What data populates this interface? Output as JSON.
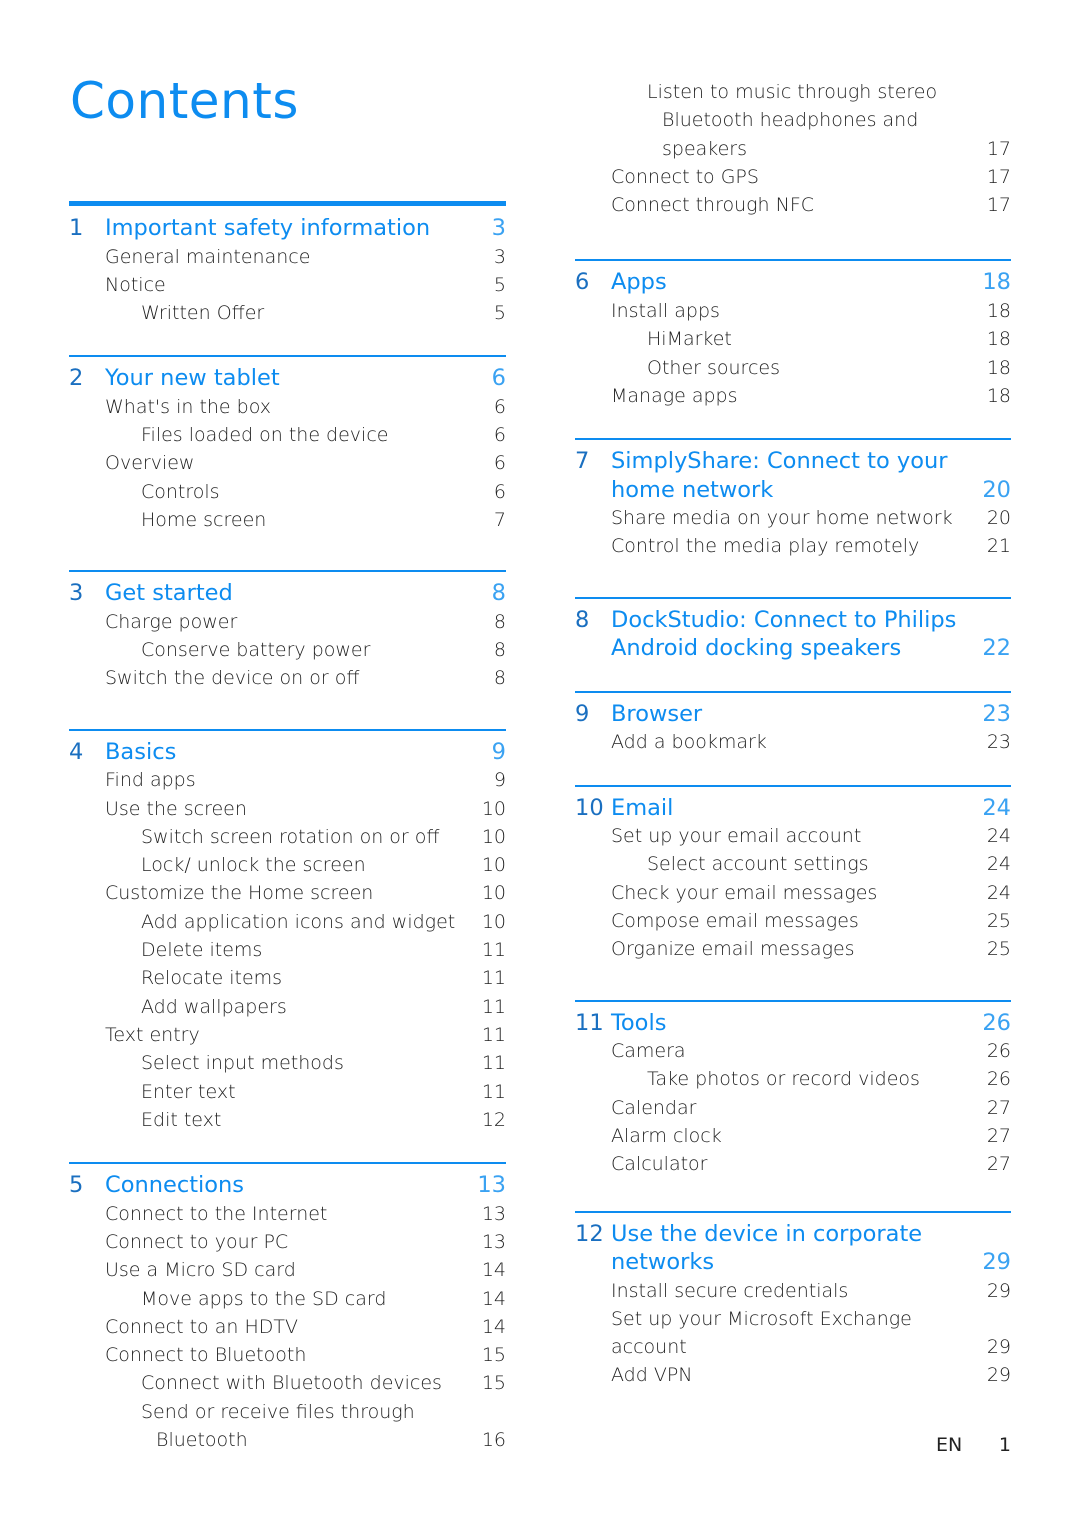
{
  "page": {
    "title": "Contents",
    "accent_color": "#0d8cf0",
    "footer": {
      "language": "EN",
      "page_number": "1"
    }
  },
  "left_column": {
    "sections": [
      {
        "number": "1",
        "title_lines": [
          "Important safety information"
        ],
        "page": "3",
        "entries": [
          {
            "level": 1,
            "lines": [
              "General maintenance"
            ],
            "page": "3"
          },
          {
            "level": 1,
            "lines": [
              "Notice"
            ],
            "page": "5"
          },
          {
            "level": 2,
            "lines": [
              "Written Offer"
            ],
            "page": "5"
          }
        ]
      },
      {
        "number": "2",
        "title_lines": [
          "Your new tablet"
        ],
        "page": "6",
        "entries": [
          {
            "level": 1,
            "lines": [
              "What's in the box"
            ],
            "page": "6"
          },
          {
            "level": 2,
            "lines": [
              "Files loaded on the device"
            ],
            "page": "6"
          },
          {
            "level": 1,
            "lines": [
              "Overview"
            ],
            "page": "6"
          },
          {
            "level": 2,
            "lines": [
              "Controls"
            ],
            "page": "6"
          },
          {
            "level": 2,
            "lines": [
              "Home screen"
            ],
            "page": "7"
          }
        ]
      },
      {
        "number": "3",
        "title_lines": [
          "Get started"
        ],
        "page": "8",
        "entries": [
          {
            "level": 1,
            "lines": [
              "Charge power"
            ],
            "page": "8"
          },
          {
            "level": 2,
            "lines": [
              "Conserve battery power"
            ],
            "page": "8"
          },
          {
            "level": 1,
            "lines": [
              "Switch the device on or off"
            ],
            "page": "8"
          }
        ]
      },
      {
        "number": "4",
        "title_lines": [
          "Basics"
        ],
        "page": "9",
        "entries": [
          {
            "level": 1,
            "lines": [
              "Find apps"
            ],
            "page": "9"
          },
          {
            "level": 1,
            "lines": [
              "Use the screen"
            ],
            "page": "10"
          },
          {
            "level": 2,
            "lines": [
              "Switch screen rotation on or off"
            ],
            "page": "10"
          },
          {
            "level": 2,
            "lines": [
              "Lock/ unlock the screen"
            ],
            "page": "10"
          },
          {
            "level": 1,
            "lines": [
              "Customize the Home screen"
            ],
            "page": "10"
          },
          {
            "level": 2,
            "lines": [
              "Add application icons and widget"
            ],
            "page": "10"
          },
          {
            "level": 2,
            "lines": [
              "Delete items"
            ],
            "page": "11"
          },
          {
            "level": 2,
            "lines": [
              "Relocate items"
            ],
            "page": "11"
          },
          {
            "level": 2,
            "lines": [
              "Add wallpapers"
            ],
            "page": "11"
          },
          {
            "level": 1,
            "lines": [
              "Text entry"
            ],
            "page": "11"
          },
          {
            "level": 2,
            "lines": [
              "Select input methods"
            ],
            "page": "11"
          },
          {
            "level": 2,
            "lines": [
              "Enter text"
            ],
            "page": "11"
          },
          {
            "level": 2,
            "lines": [
              "Edit text"
            ],
            "page": "12"
          }
        ]
      },
      {
        "number": "5",
        "title_lines": [
          "Connections"
        ],
        "page": "13",
        "entries": [
          {
            "level": 1,
            "lines": [
              "Connect to the Internet"
            ],
            "page": "13"
          },
          {
            "level": 1,
            "lines": [
              "Connect to your PC"
            ],
            "page": "13"
          },
          {
            "level": 1,
            "lines": [
              "Use a Micro SD card"
            ],
            "page": "14"
          },
          {
            "level": 2,
            "lines": [
              "Move apps to the SD card"
            ],
            "page": "14"
          },
          {
            "level": 1,
            "lines": [
              "Connect to an HDTV"
            ],
            "page": "14"
          },
          {
            "level": 1,
            "lines": [
              "Connect to Bluetooth"
            ],
            "page": "15"
          },
          {
            "level": 2,
            "lines": [
              "Connect with Bluetooth devices"
            ],
            "page": "15"
          },
          {
            "level": 2,
            "lines": [
              "Send or receive files through",
              "Bluetooth"
            ],
            "page": "16"
          }
        ]
      }
    ]
  },
  "right_column": {
    "continued_entries": [
      {
        "level": 2,
        "lines": [
          "Listen to music through stereo",
          "Bluetooth headphones and",
          "speakers"
        ],
        "page": "17"
      },
      {
        "level": 1,
        "lines": [
          "Connect to GPS"
        ],
        "page": "17"
      },
      {
        "level": 1,
        "lines": [
          "Connect through NFC"
        ],
        "page": "17"
      }
    ],
    "sections": [
      {
        "number": "6",
        "title_lines": [
          "Apps"
        ],
        "page": "18",
        "entries": [
          {
            "level": 1,
            "lines": [
              "Install apps"
            ],
            "page": "18"
          },
          {
            "level": 2,
            "lines": [
              "HiMarket"
            ],
            "page": "18"
          },
          {
            "level": 2,
            "lines": [
              "Other sources"
            ],
            "page": "18"
          },
          {
            "level": 1,
            "lines": [
              "Manage apps"
            ],
            "page": "18"
          }
        ]
      },
      {
        "number": "7",
        "title_lines": [
          "SimplyShare: Connect to your",
          "home network"
        ],
        "page": "20",
        "entries": [
          {
            "level": 1,
            "lines": [
              "Share media on your home network"
            ],
            "page": "20"
          },
          {
            "level": 1,
            "lines": [
              "Control the media play remotely"
            ],
            "page": "21"
          }
        ]
      },
      {
        "number": "8",
        "title_lines": [
          "DockStudio: Connect to Philips",
          "Android docking speakers"
        ],
        "page": "22",
        "entries": []
      },
      {
        "number": "9",
        "title_lines": [
          "Browser"
        ],
        "page": "23",
        "entries": [
          {
            "level": 1,
            "lines": [
              "Add a bookmark"
            ],
            "page": "23"
          }
        ]
      },
      {
        "number": "10",
        "title_lines": [
          "Email"
        ],
        "page": "24",
        "entries": [
          {
            "level": 1,
            "lines": [
              "Set up your email account"
            ],
            "page": "24"
          },
          {
            "level": 2,
            "lines": [
              "Select account settings"
            ],
            "page": "24"
          },
          {
            "level": 1,
            "lines": [
              "Check your email messages"
            ],
            "page": "24"
          },
          {
            "level": 1,
            "lines": [
              "Compose email messages"
            ],
            "page": "25"
          },
          {
            "level": 1,
            "lines": [
              "Organize email messages"
            ],
            "page": "25"
          }
        ]
      },
      {
        "number": "11",
        "title_lines": [
          "Tools"
        ],
        "page": "26",
        "entries": [
          {
            "level": 1,
            "lines": [
              "Camera"
            ],
            "page": "26"
          },
          {
            "level": 2,
            "lines": [
              "Take photos or record videos"
            ],
            "page": "26"
          },
          {
            "level": 1,
            "lines": [
              "Calendar"
            ],
            "page": "27"
          },
          {
            "level": 1,
            "lines": [
              "Alarm clock"
            ],
            "page": "27"
          },
          {
            "level": 1,
            "lines": [
              "Calculator"
            ],
            "page": "27"
          }
        ]
      },
      {
        "number": "12",
        "title_lines": [
          "Use the device in corporate",
          "networks"
        ],
        "page": "29",
        "entries": [
          {
            "level": 1,
            "lines": [
              "Install secure credentials"
            ],
            "page": "29"
          },
          {
            "level": 1,
            "lines": [
              "Set up your Microsoft Exchange account"
            ],
            "page": "29"
          },
          {
            "level": 1,
            "lines": [
              "Add VPN"
            ],
            "page": "29"
          }
        ]
      }
    ]
  }
}
